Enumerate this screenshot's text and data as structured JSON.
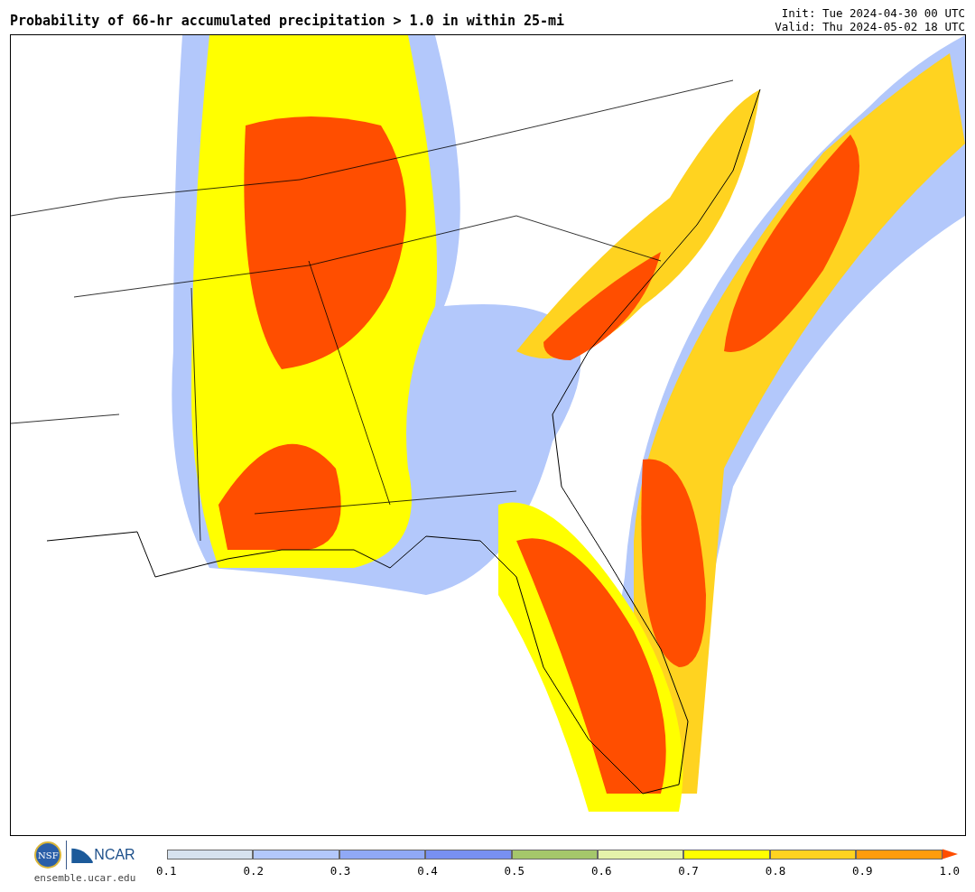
{
  "title": "Probability of 66-hr accumulated precipitation > 1.0 in within 25-mi",
  "init": "Init: Tue 2024-04-30 00 UTC",
  "valid": "Valid: Thu 2024-05-02 18 UTC",
  "footer": {
    "emblem_text": "NSF",
    "logo_text": "NCAR",
    "url": "ensemble.ucar.edu"
  },
  "colorbar": {
    "segments": [
      {
        "color": "#d6e2ee"
      },
      {
        "color": "#b3c8fb"
      },
      {
        "color": "#90a9f6"
      },
      {
        "color": "#7890f1"
      },
      {
        "color": "#a5c76b"
      },
      {
        "color": "#e5f2aa"
      },
      {
        "color": "#ffff00"
      },
      {
        "color": "#ffd320"
      },
      {
        "color": "#ff9c0c"
      }
    ],
    "extend": {
      "color": "#ff4e00"
    },
    "ticks": [
      "0.1",
      "0.2",
      "0.3",
      "0.4",
      "0.5",
      "0.6",
      "0.7",
      "0.8",
      "0.9",
      "1.0"
    ]
  }
}
